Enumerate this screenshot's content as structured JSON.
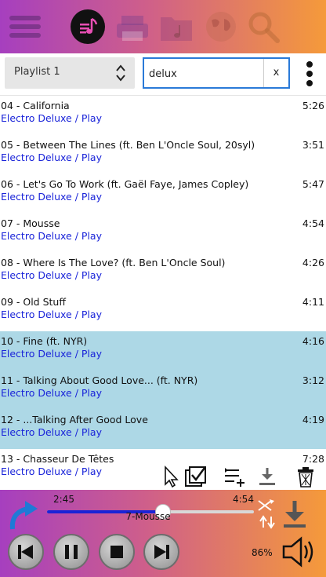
{
  "topbar": {
    "icons": [
      "menu-icon",
      "music-note-icon",
      "printer-icon",
      "music-folder-icon",
      "globe-icon",
      "search-icon"
    ]
  },
  "controls": {
    "playlist_selected": "Playlist 1",
    "search_value": "delux",
    "clear_label": "x"
  },
  "tracks": [
    {
      "title": "04 - California",
      "artist": "Electro Deluxe / Play",
      "duration": "5:26",
      "selected": false
    },
    {
      "title": "05 - Between The Lines (ft. Ben L'Oncle Soul, 20syl)",
      "artist": "Electro Deluxe / Play",
      "duration": "3:51",
      "selected": false
    },
    {
      "title": "06 - Let's Go To Work (ft. Gaël Faye, James Copley)",
      "artist": "Electro Deluxe / Play",
      "duration": "5:47",
      "selected": false
    },
    {
      "title": "07 - Mousse",
      "artist": "Electro Deluxe / Play",
      "duration": "4:54",
      "selected": false
    },
    {
      "title": "08 - Where Is The Love? (ft. Ben L'Oncle Soul)",
      "artist": "Electro Deluxe / Play",
      "duration": "4:26",
      "selected": false
    },
    {
      "title": "09 - Old Stuff",
      "artist": "Electro Deluxe / Play",
      "duration": "4:11",
      "selected": false
    },
    {
      "title": "10 - Fine (ft. NYR)",
      "artist": "Electro Deluxe / Play",
      "duration": "4:16",
      "selected": true
    },
    {
      "title": "11 - Talking About Good Love... (ft. NYR)",
      "artist": "Electro Deluxe / Play",
      "duration": "3:12",
      "selected": true
    },
    {
      "title": "12 - ...Talking After Good Love",
      "artist": "Electro Deluxe / Play",
      "duration": "4:19",
      "selected": true
    },
    {
      "title": "13 - Chasseur De Têtes",
      "artist": "Electro Deluxe / Play",
      "duration": "7:28",
      "selected": false
    }
  ],
  "actions": {
    "icons": [
      "cursor-icon",
      "select-all-icon",
      "add-to-queue-icon",
      "download-icon",
      "trash-icon"
    ]
  },
  "player": {
    "current_time": "2:45",
    "total_time": "4:54",
    "progress_fraction": 0.561,
    "now_playing": "7-Mousse",
    "volume": "86%"
  },
  "colors": {
    "gradient_start": "#a63fbf",
    "gradient_end": "#f59a3a",
    "link_blue": "#1a24d9",
    "selected_row": "#add8e6",
    "progress_fill": "#1a23d6",
    "search_border": "#2a7ad8"
  }
}
